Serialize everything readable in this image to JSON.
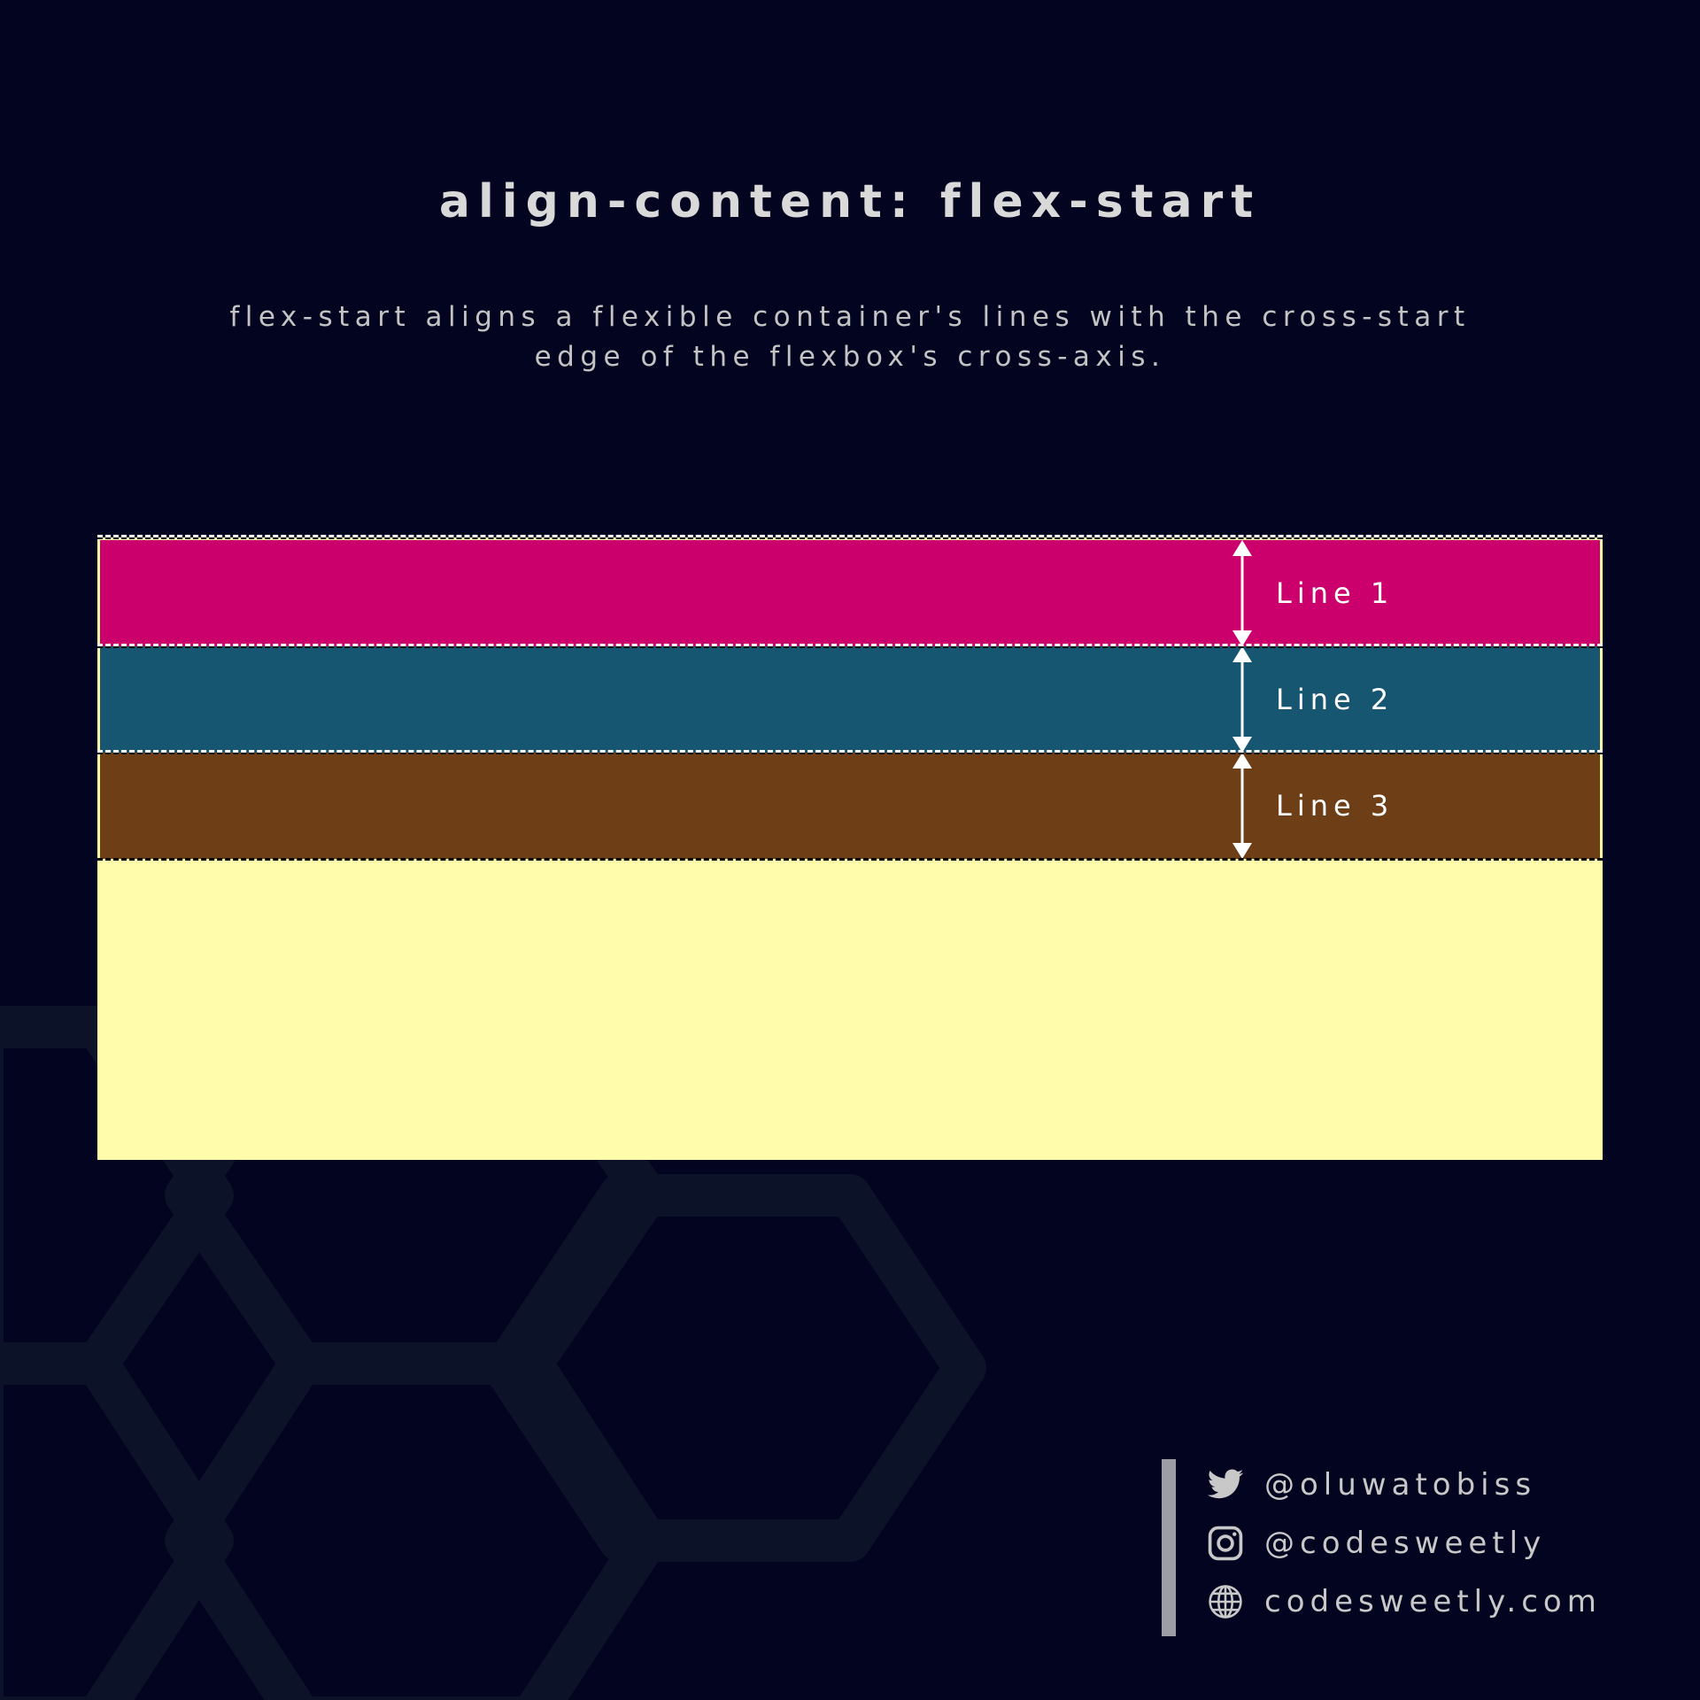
{
  "header": {
    "title": "align-content: flex-start",
    "description": "flex-start aligns a flexible container's lines with the cross-start edge of the flexbox's cross-axis."
  },
  "diagram": {
    "container_color": "#fffdab",
    "lines": [
      {
        "label": "Line 1",
        "color": "#cc006c"
      },
      {
        "label": "Line 2",
        "color": "#175670"
      },
      {
        "label": "Line 3",
        "color": "#6e3e16"
      }
    ]
  },
  "social": {
    "twitter": {
      "handle": "@oluwatobiss",
      "icon": "twitter-icon"
    },
    "instagram": {
      "handle": "@codesweetly",
      "icon": "instagram-icon"
    },
    "website": {
      "url": "codesweetly.com",
      "icon": "globe-icon"
    },
    "accent_bar_color": "#9d9da5"
  }
}
